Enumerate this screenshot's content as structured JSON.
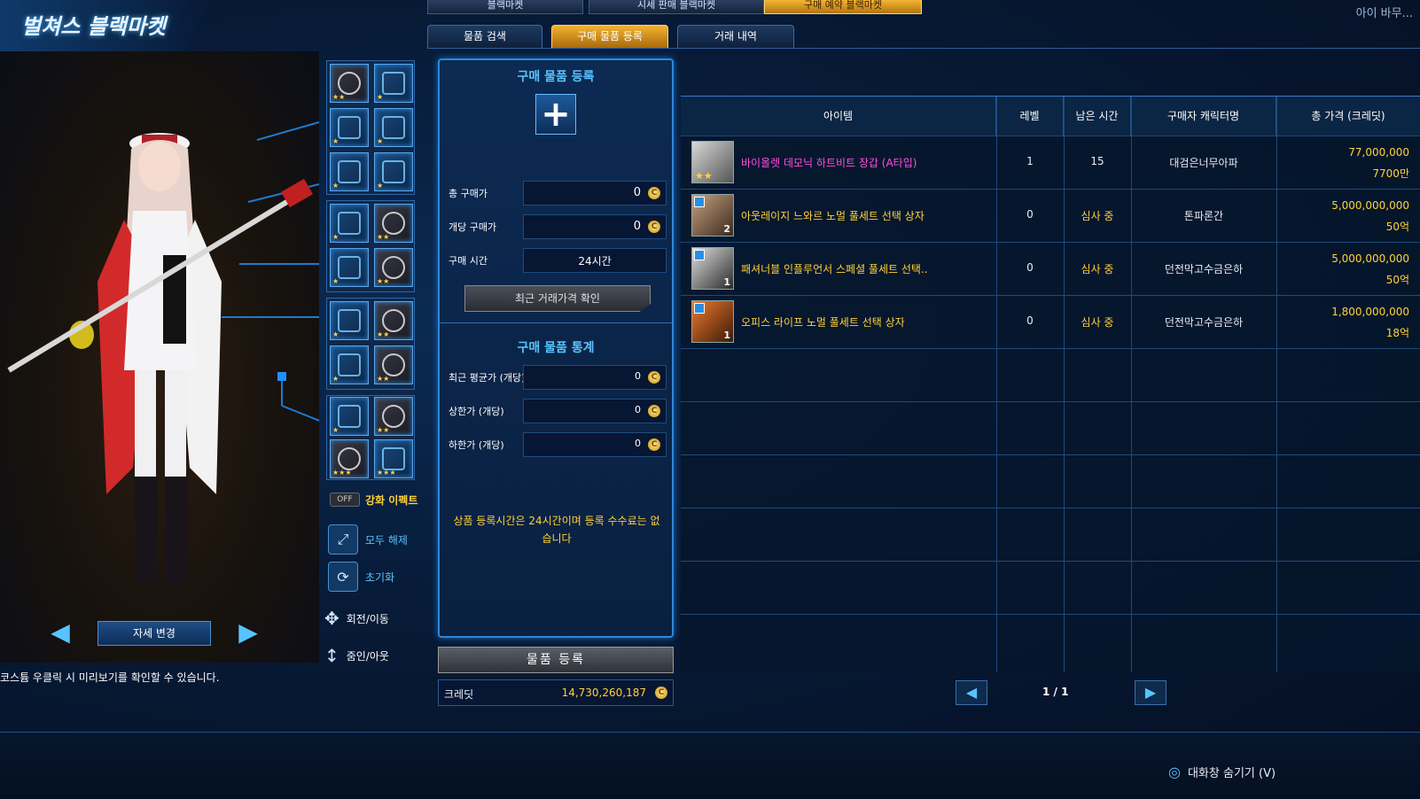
{
  "top_tabs": [
    {
      "label": "블랙마켓",
      "active": false
    },
    {
      "label": "시세 판매 블랙마켓",
      "active": false
    },
    {
      "label": "구매 예약 블랙마켓",
      "active": true
    }
  ],
  "header": {
    "title": "벌쳐스 블랙마켓",
    "server_info": "아이 바무..."
  },
  "sub_tabs": [
    {
      "label": "물품 검색",
      "active": false
    },
    {
      "label": "구매 물품 등록",
      "active": true
    },
    {
      "label": "거래 내역",
      "active": false
    }
  ],
  "left": {
    "effect_toggle": "OFF",
    "effect_label": "강화 이펙트",
    "release_all": "모두 해제",
    "reset": "초기화",
    "rotate": "회전/이동",
    "zoom": "줌인/아웃",
    "pose_change": "자세 변경",
    "hint": "코스튬 우클릭 시 미리보기를 확인할 수 있습니다."
  },
  "register": {
    "title": "구매 물품 등록",
    "total_price_label": "총 구매가",
    "total_price": "0",
    "unit_price_label": "개당 구매가",
    "unit_price": "0",
    "time_label": "구매 시간",
    "time_value": "24시간",
    "recent_price_btn": "최근 거래가격 확인",
    "stats_title": "구매 물품 통계",
    "avg_label": "최근 평균가 (개당)",
    "avg_value": "0",
    "max_label": "상한가 (개당)",
    "max_value": "0",
    "min_label": "하한가 (개당)",
    "min_value": "0",
    "notice": "상품 등록시간은 24시간이며 등록 수수료는 없습니다",
    "register_btn": "물품 등록",
    "credit_label": "크레딧",
    "credit_value": "14,730,260,187",
    "coin_glyph": "C"
  },
  "table": {
    "headers": [
      "아이템",
      "레벨",
      "남은 시간",
      "구매자 캐릭터명",
      "총 가격 (크레딧)"
    ],
    "rows": [
      {
        "name": "바이올렛 데모닉 하트비트 장갑 (A타입)",
        "name_color": "#ff4de0",
        "level": "1",
        "time": "15",
        "buyer": "대검은너무아파",
        "price": "77,000,000",
        "price_short": "7700만",
        "thumb_icon": "glove-icon",
        "thumb_count": "",
        "stars": "★★"
      },
      {
        "name": "아웃레이지 느와르 노멀 풀세트 선택 상자",
        "name_color": "#ffd23a",
        "level": "0",
        "time": "심사 중",
        "buyer": "톤파론간",
        "price": "5,000,000,000",
        "price_short": "50억",
        "thumb_icon": "box-icon",
        "thumb_count": "2",
        "stars": ""
      },
      {
        "name": "패셔너블 인플루언서 스페셜 풀세트 선택..",
        "name_color": "#ffd23a",
        "level": "0",
        "time": "심사 중",
        "buyer": "던전막고수금은하",
        "price": "5,000,000,000",
        "price_short": "50억",
        "thumb_icon": "box-icon",
        "thumb_count": "1",
        "stars": ""
      },
      {
        "name": "오피스 라이프 노멀 풀세트 선택 상자",
        "name_color": "#ffd23a",
        "level": "0",
        "time": "심사 중",
        "buyer": "던전막고수금은하",
        "price": "1,800,000,000",
        "price_short": "18억",
        "thumb_icon": "box-icon",
        "thumb_count": "1",
        "stars": ""
      }
    ]
  },
  "pager": {
    "text": "1 / 1",
    "prev": "◀",
    "next": "▶"
  },
  "bottom": {
    "hide_chat": "대화창 숨기기 (V)"
  },
  "colors": {
    "accent": "#59c3ff",
    "gold": "#ffd23a",
    "tab_active": "#f2b632"
  }
}
